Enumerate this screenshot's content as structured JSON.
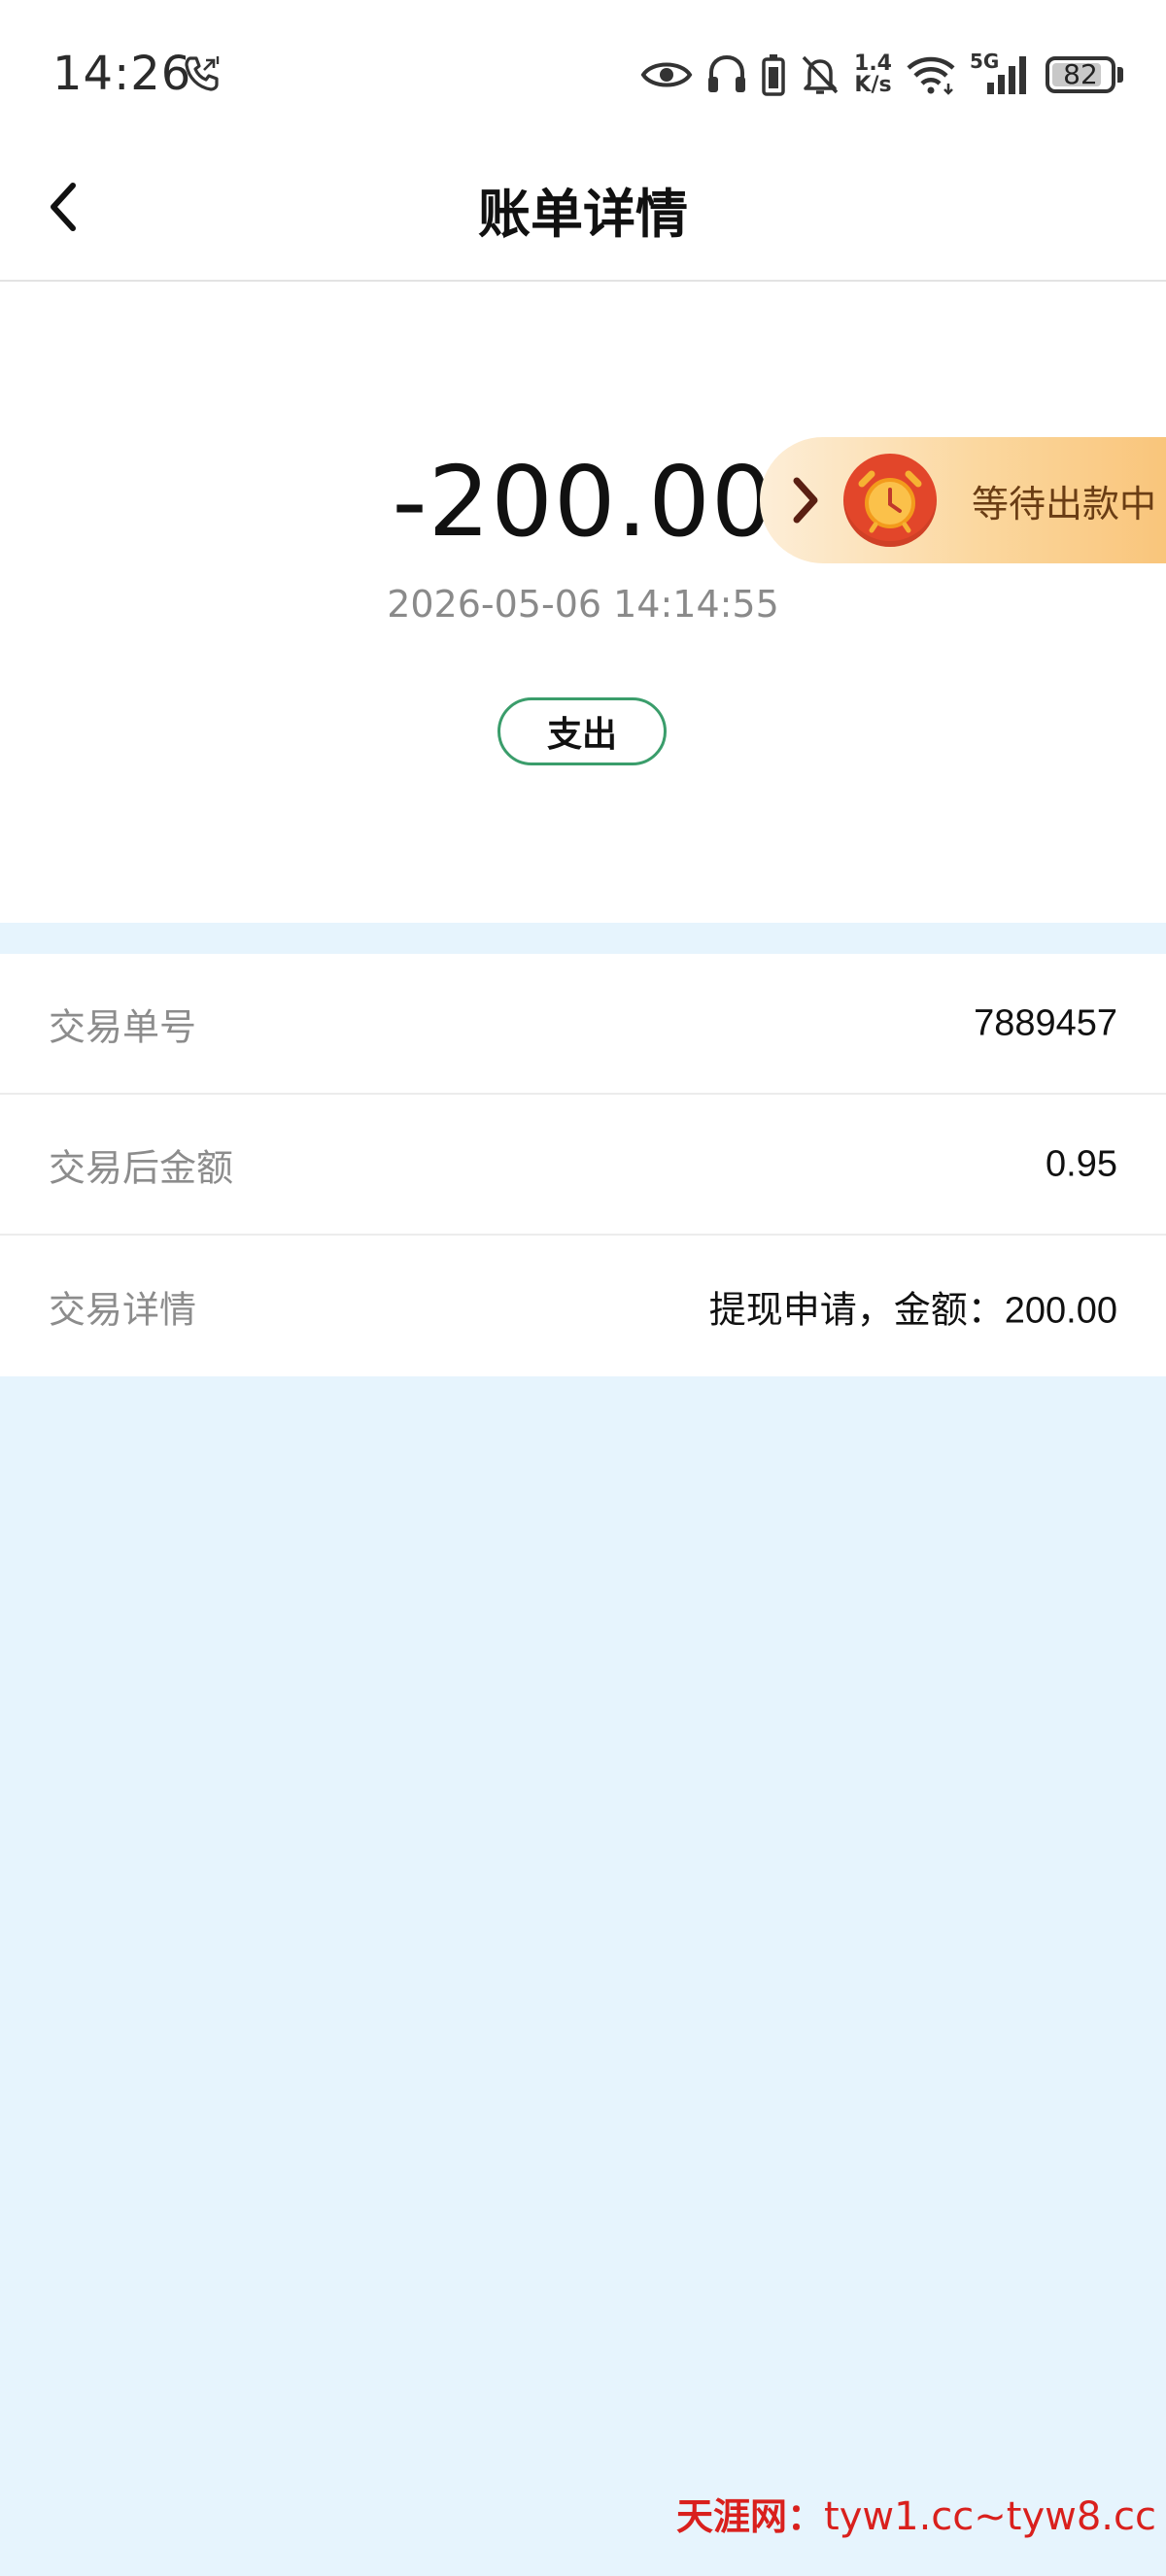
{
  "status_bar": {
    "time": "14:26",
    "net_speed_value": "1.4",
    "net_speed_unit": "K/s",
    "network_type": "5G",
    "battery": "82"
  },
  "header": {
    "title": "账单详情",
    "back_icon": "chevron-left-icon"
  },
  "summary": {
    "amount": "-200.00",
    "datetime": "2026-05-06 14:14:55",
    "type_label": "支出",
    "status_label": "等待出款中",
    "status_icon": "alarm-clock-icon",
    "accent_color": "#3a9d6b"
  },
  "details": [
    {
      "label": "交易单号",
      "value": "7889457"
    },
    {
      "label": "交易后金额",
      "value": "0.95"
    },
    {
      "label": "交易详情",
      "value": "提现申请，金额：200.00"
    }
  ],
  "watermark": {
    "brand": "天涯网：",
    "urls": "tyw1.cc~tyw8.cc"
  }
}
